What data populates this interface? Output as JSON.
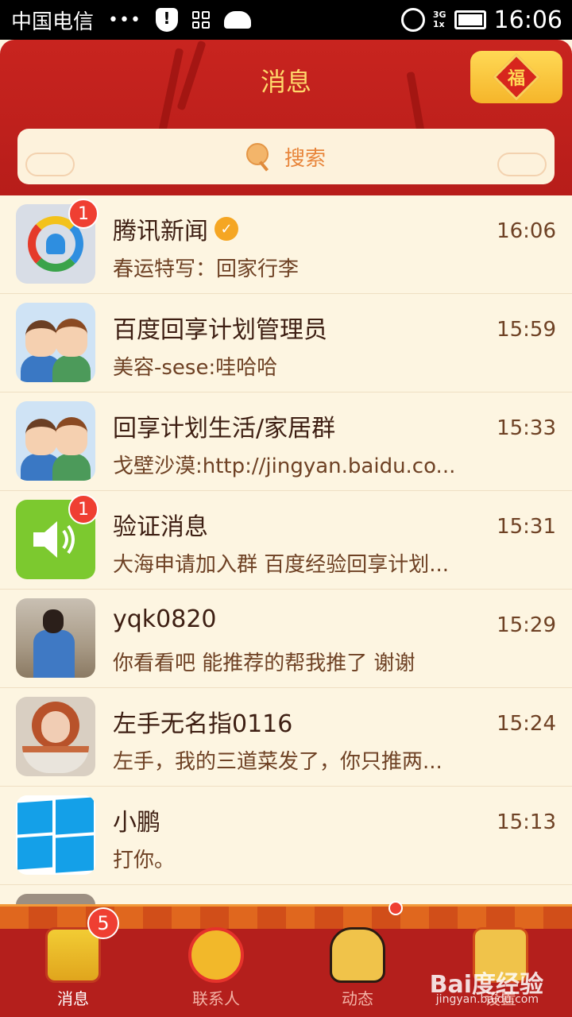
{
  "status_bar": {
    "carrier": "中国电信",
    "dots": "•••",
    "network": "3G",
    "network_sub": "1x",
    "time": "16:06"
  },
  "header": {
    "title": "消息",
    "fu_char": "福",
    "search_placeholder": "搜索"
  },
  "conversations": [
    {
      "name": "腾讯新闻",
      "verified": true,
      "badge": "1",
      "message": "春运特写：回家行李",
      "time": "16:06",
      "avatar": "tencent-news-icon"
    },
    {
      "name": "百度回享计划管理员",
      "message": "美容-sese:哇哈哈",
      "time": "15:59",
      "avatar": "group-avatar-icon"
    },
    {
      "name": "回享计划生活/家居群",
      "message": "戈壁沙漠:http://jingyan.baidu.co...",
      "time": "15:33",
      "avatar": "group-avatar-icon"
    },
    {
      "name": "验证消息",
      "badge": "1",
      "message": "大海申请加入群 百度经验回享计划...",
      "time": "15:31",
      "avatar": "speaker-icon"
    },
    {
      "name": "yqk0820",
      "message": "你看看吧 能推荐的帮我推了 谢谢",
      "time": "15:29",
      "avatar": "man-photo"
    },
    {
      "name": "左手无名指0116",
      "message": "左手，我的三道菜发了，你只推两...",
      "time": "15:24",
      "avatar": "girl-photo"
    },
    {
      "name": "小鹏",
      "message": "打你。",
      "time": "15:13",
      "avatar": "windows-logo-icon"
    }
  ],
  "tabs": [
    {
      "label": "消息",
      "badge": "5",
      "active": true
    },
    {
      "label": "联系人"
    },
    {
      "label": "动态"
    },
    {
      "label": "设置"
    }
  ],
  "watermark": {
    "text": "Bai度经验",
    "url": "jingyan.baidu.com"
  },
  "colors": {
    "header_red": "#c8241f",
    "title_gold": "#ffd86b",
    "badge_red": "#ef3f32",
    "list_bg": "#fdf5e1"
  }
}
